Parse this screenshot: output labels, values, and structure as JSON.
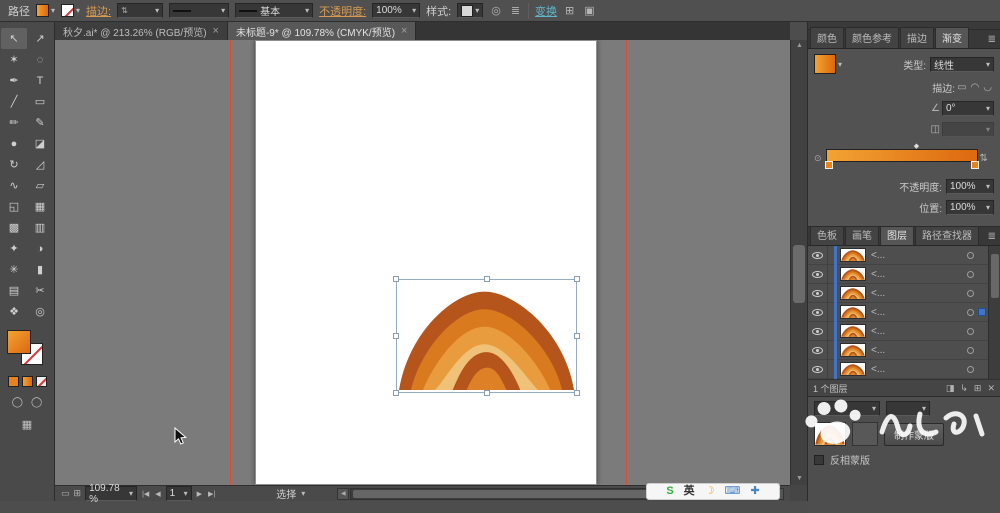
{
  "ui_colors": {
    "accent_orange": "#E8821E",
    "guide_red": "#E14B2B",
    "selection_blue": "#3F74C9",
    "link_orange": "#D89A50",
    "link_teal": "#5FB6C9",
    "grad_a": "#F2A333",
    "grad_b": "#DD680F"
  },
  "artwork": {
    "band_colors": [
      "#B5551B",
      "#DA7A1F",
      "#E99C3D",
      "#F0C179",
      "#B5551B",
      "#DE8126"
    ]
  },
  "control_bar": {
    "selection_type": "路径",
    "stroke_link": "描边:",
    "brush_value": "基本",
    "opacity_link": "不透明度:",
    "opacity_value": "100%",
    "style_label": "样式:",
    "transform_link": "变换"
  },
  "document_tabs": [
    {
      "title": "秋夕.ai* @ 213.26% (RGB/预览)",
      "close_glyph": "×"
    },
    {
      "title": "未标题-9* @ 109.78% (CMYK/预览)",
      "close_glyph": "×"
    }
  ],
  "toolbar": {
    "tools": [
      {
        "name": "selection-tool-icon",
        "glyph": "↖"
      },
      {
        "name": "direct-selection-tool-icon",
        "glyph": "↗"
      },
      {
        "name": "magic-wand-tool-icon",
        "glyph": "✶"
      },
      {
        "name": "lasso-tool-icon",
        "glyph": "◌"
      },
      {
        "name": "pen-tool-icon",
        "glyph": "✒"
      },
      {
        "name": "type-tool-icon",
        "glyph": "T"
      },
      {
        "name": "line-tool-icon",
        "glyph": "╱"
      },
      {
        "name": "rectangle-tool-icon",
        "glyph": "▭"
      },
      {
        "name": "paintbrush-tool-icon",
        "glyph": "✏"
      },
      {
        "name": "pencil-tool-icon",
        "glyph": "✎"
      },
      {
        "name": "blob-brush-tool-icon",
        "glyph": "●"
      },
      {
        "name": "eraser-tool-icon",
        "glyph": "◪"
      },
      {
        "name": "rotate-tool-icon",
        "glyph": "↻"
      },
      {
        "name": "scale-tool-icon",
        "glyph": "◿"
      },
      {
        "name": "width-tool-icon",
        "glyph": "∿"
      },
      {
        "name": "free-transform-tool-icon",
        "glyph": "▱"
      },
      {
        "name": "shape-builder-tool-icon",
        "glyph": "◱"
      },
      {
        "name": "perspective-grid-tool-icon",
        "glyph": "▦"
      },
      {
        "name": "mesh-tool-icon",
        "glyph": "▩"
      },
      {
        "name": "gradient-tool-icon",
        "glyph": "▥"
      },
      {
        "name": "eyedropper-tool-icon",
        "glyph": "✦"
      },
      {
        "name": "blend-tool-icon",
        "glyph": "◑"
      },
      {
        "name": "symbol-sprayer-tool-icon",
        "glyph": "✳"
      },
      {
        "name": "graph-tool-icon",
        "glyph": "▮"
      },
      {
        "name": "artboard-tool-icon",
        "glyph": "▤"
      },
      {
        "name": "slice-tool-icon",
        "glyph": "✂"
      },
      {
        "name": "hand-tool-icon",
        "glyph": "❖"
      },
      {
        "name": "zoom-tool-icon",
        "glyph": "◎"
      }
    ]
  },
  "gradient_panel": {
    "tabs": [
      {
        "id": "color",
        "label": "颜色"
      },
      {
        "id": "color-guide",
        "label": "颜色参考"
      },
      {
        "id": "stroke",
        "label": "描边"
      },
      {
        "id": "gradient",
        "label": "渐变",
        "active": true
      }
    ],
    "type_label": "类型:",
    "type_value": "线性",
    "stroke_label": "描边:",
    "angle_value": "0°",
    "opacity_label": "不透明度:",
    "opacity_value": "100%",
    "location_label": "位置:",
    "location_value": "100%"
  },
  "panels2_tabs": [
    {
      "id": "swatches",
      "label": "色板"
    },
    {
      "id": "brushes",
      "label": "画笔"
    },
    {
      "id": "layers",
      "label": "图层",
      "active": true
    },
    {
      "id": "pathfinder",
      "label": "路径查找器"
    }
  ],
  "layers_panel": {
    "rows": [
      {
        "name": "<..."
      },
      {
        "name": "<..."
      },
      {
        "name": "<..."
      },
      {
        "name": "<..."
      },
      {
        "name": "<..."
      },
      {
        "name": "<..."
      },
      {
        "name": "<..."
      }
    ],
    "status": "1 个图层"
  },
  "transparency_panel": {
    "make_mask_label": "制作蒙版",
    "invert_mask_label": "反相蒙版"
  },
  "status_bar": {
    "zoom_value": "109.78 %",
    "artboard_value": "1",
    "tool_status": "选择"
  },
  "ime": {
    "items": [
      {
        "name": "sogou-logo-icon",
        "glyph": "S",
        "color": "#2FAF3C"
      },
      {
        "name": "ime-mode-indicator",
        "glyph": "英",
        "color": "#333333"
      },
      {
        "name": "night-mode-icon",
        "glyph": "☽",
        "color": "#F0A22B"
      },
      {
        "name": "soft-keyboard-icon",
        "glyph": "⌨",
        "color": "#4A85C8"
      },
      {
        "name": "toolbox-icon",
        "glyph": "✚",
        "color": "#4A85C8"
      }
    ]
  }
}
